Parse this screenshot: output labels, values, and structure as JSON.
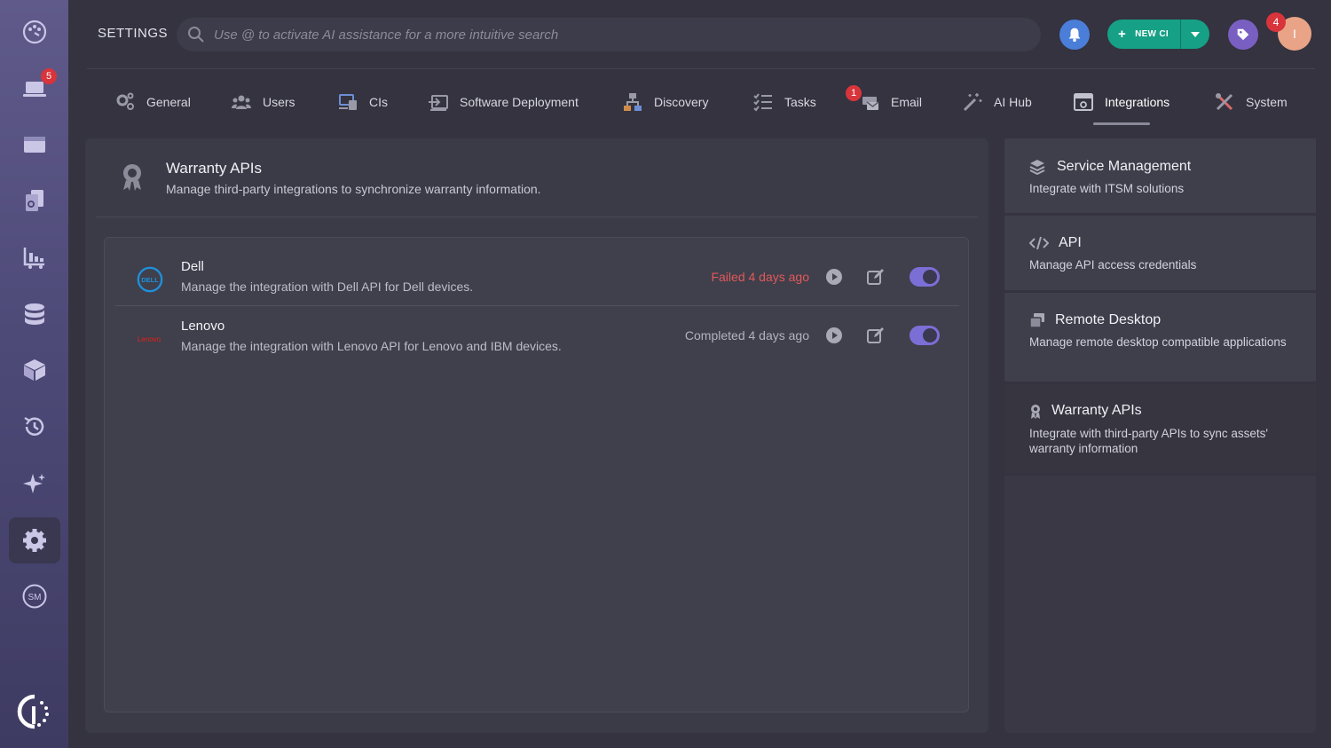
{
  "header": {
    "title": "SETTINGS",
    "search_placeholder": "Use @ to activate AI assistance for a more intuitive search",
    "new_ci_label": "NEW CI",
    "avatar_initial": "I",
    "avatar_badge": "4"
  },
  "rail": {
    "items": [
      {
        "icon": "palette-icon"
      },
      {
        "icon": "laptop-icon",
        "badge": "5"
      },
      {
        "icon": "window-icon"
      },
      {
        "icon": "documents-icon"
      },
      {
        "icon": "chart-cart-icon"
      },
      {
        "icon": "database-icon"
      },
      {
        "icon": "box-icon"
      },
      {
        "icon": "history-icon"
      },
      {
        "icon": "sparkle-icon"
      },
      {
        "icon": "gear-icon",
        "active": true
      },
      {
        "icon": "sm-icon",
        "text": "SM"
      }
    ]
  },
  "tabs": {
    "items": [
      {
        "label": "General",
        "icon": "gears-icon"
      },
      {
        "label": "Users",
        "icon": "users-icon"
      },
      {
        "label": "CIs",
        "icon": "ci-icon"
      },
      {
        "label": "Software Deployment",
        "icon": "deploy-icon"
      },
      {
        "label": "Discovery",
        "icon": "network-icon"
      },
      {
        "label": "Tasks",
        "icon": "tasks-icon"
      },
      {
        "label": "Email",
        "icon": "email-icon",
        "badge": "1"
      },
      {
        "label": "AI Hub",
        "icon": "magic-wand-icon"
      },
      {
        "label": "Integrations",
        "icon": "integrations-icon",
        "active": true
      },
      {
        "label": "System",
        "icon": "tools-icon"
      }
    ]
  },
  "main": {
    "title": "Warranty APIs",
    "description": "Manage third-party integrations to synchronize warranty information.",
    "integrations": [
      {
        "name": "Dell",
        "logo": "DELL",
        "description": "Manage the integration with Dell API for Dell devices.",
        "status": "Failed 4 days ago",
        "status_type": "failed",
        "enabled": true
      },
      {
        "name": "Lenovo",
        "logo": "Lenovo",
        "description": "Manage the integration with Lenovo API for Lenovo and IBM devices.",
        "status": "Completed 4 days ago",
        "status_type": "ok",
        "enabled": true
      }
    ]
  },
  "side": {
    "cards": [
      {
        "title": "Service Management",
        "description": "Integrate with ITSM solutions",
        "icon": "layers-icon"
      },
      {
        "title": "API",
        "description": "Manage API access credentials",
        "icon": "code-icon"
      },
      {
        "title": "Remote Desktop",
        "description": "Manage remote desktop compatible applications",
        "icon": "windows-icon"
      },
      {
        "title": "Warranty APIs",
        "description": "Integrate with third-party APIs to sync assets' warranty information",
        "icon": "award-icon",
        "active": true
      }
    ]
  },
  "colors": {
    "accent_green": "#16a085",
    "toggle_on": "#7b6fd6",
    "failed": "#e05a5a",
    "badge_red": "#d8343b"
  }
}
